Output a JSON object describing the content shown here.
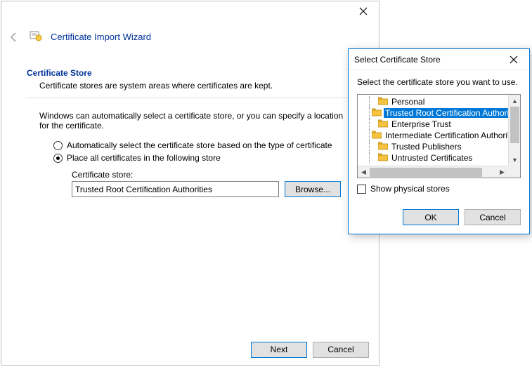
{
  "main": {
    "title": "Certificate Import Wizard",
    "section_title": "Certificate Store",
    "description": "Certificate stores are system areas where certificates are kept.",
    "instruction": "Windows can automatically select a certificate store, or you can specify a location for the certificate.",
    "radio_auto": "Automatically select the certificate store based on the type of certificate",
    "radio_place": "Place all certificates in the following store",
    "store_label": "Certificate store:",
    "store_value": "Trusted Root Certification Authorities",
    "browse": "Browse...",
    "next": "Next",
    "cancel": "Cancel"
  },
  "sub": {
    "title": "Select Certificate Store",
    "instruction": "Select the certificate store you want to use.",
    "items": [
      "Personal",
      "Trusted Root Certification Authorities",
      "Enterprise Trust",
      "Intermediate Certification Authorities",
      "Trusted Publishers",
      "Untrusted Certificates"
    ],
    "selected_index": 1,
    "show_physical": "Show physical stores",
    "ok": "OK",
    "cancel": "Cancel"
  }
}
